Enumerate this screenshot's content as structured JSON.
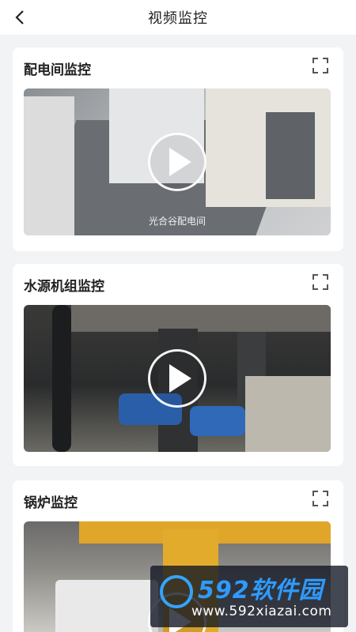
{
  "header": {
    "title": "视频监控"
  },
  "cards": [
    {
      "title": "配电间监控",
      "caption": "光合谷配电间"
    },
    {
      "title": "水源机组监控"
    },
    {
      "title": "锅炉监控"
    }
  ],
  "watermark": {
    "brand": "592软件园",
    "url": "www.592xiazai.com"
  },
  "icons": {
    "back": "chevron-left-icon",
    "fullscreen": "fullscreen-icon",
    "play": "play-icon"
  }
}
